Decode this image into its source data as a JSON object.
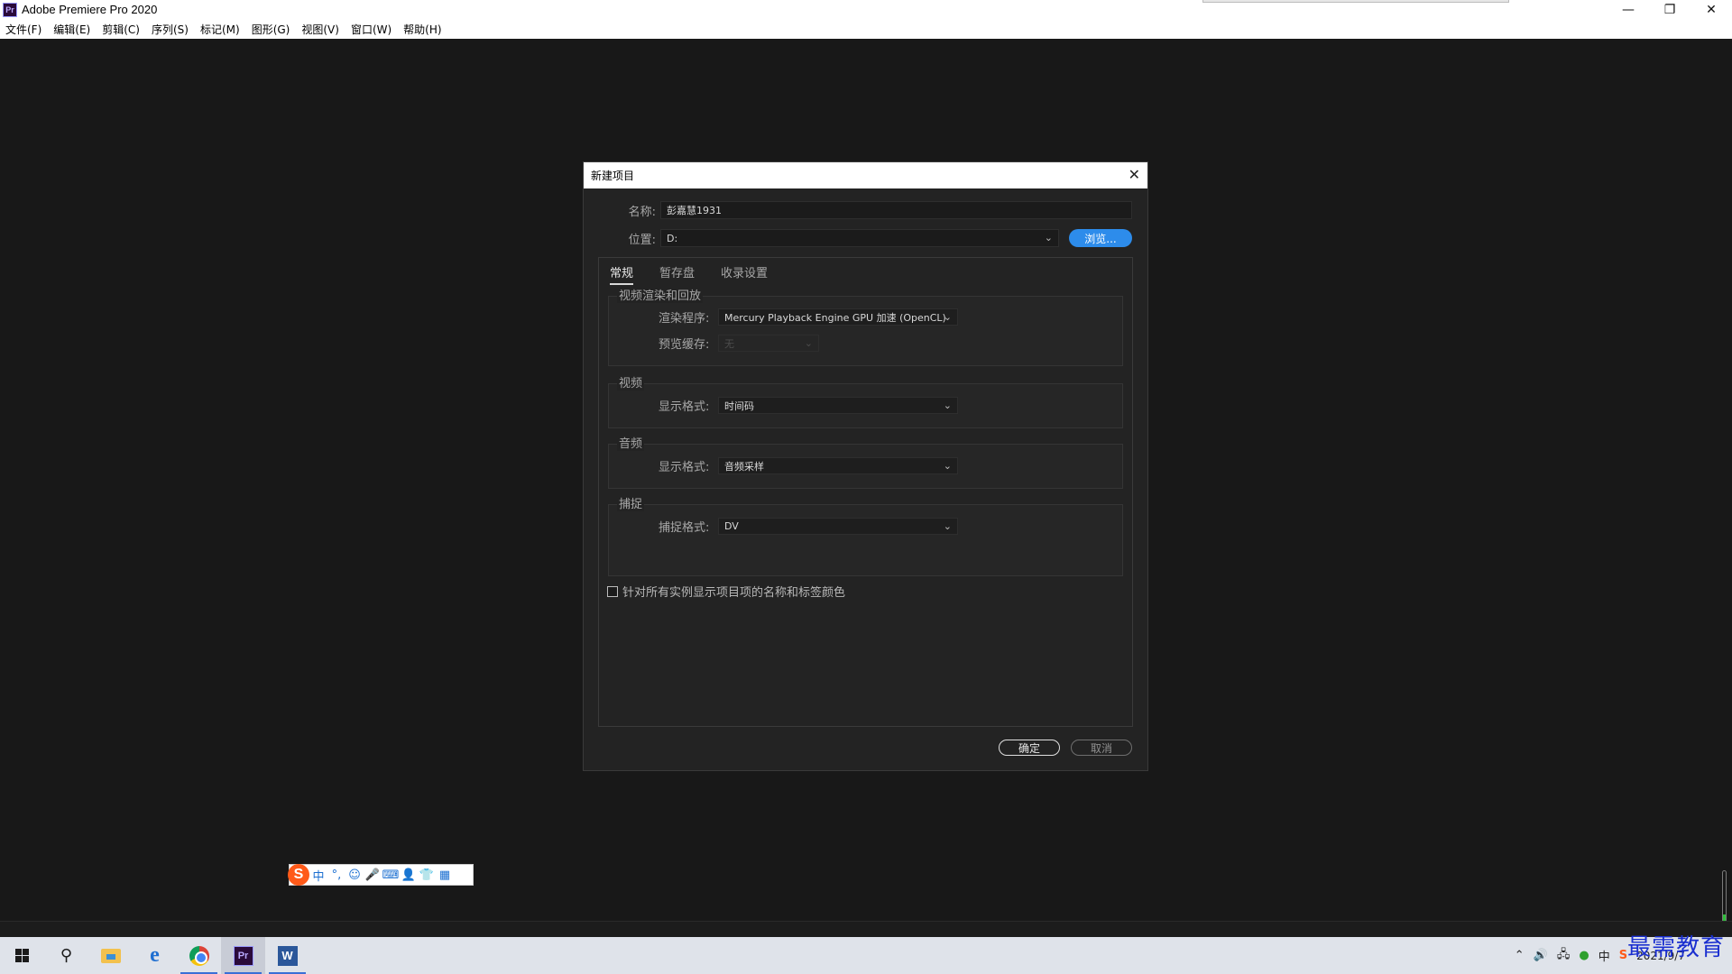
{
  "window": {
    "title": "Adobe Premiere Pro 2020",
    "controls": [
      "—",
      "❐",
      "✕"
    ]
  },
  "menu": [
    "文件(F)",
    "编辑(E)",
    "剪辑(C)",
    "序列(S)",
    "标记(M)",
    "图形(G)",
    "视图(V)",
    "窗口(W)",
    "帮助(H)"
  ],
  "dialog": {
    "title": "新建项目",
    "name_label": "名称:",
    "name_value": "彭嘉慧1931",
    "location_label": "位置:",
    "location_value": "D:",
    "browse_label": "浏览...",
    "tabs": [
      "常规",
      "暂存盘",
      "收录设置"
    ],
    "groups": {
      "render": {
        "title": "视频渲染和回放",
        "renderer_label": "渲染程序:",
        "renderer_value": "Mercury Playback Engine GPU 加速 (OpenCL)",
        "preview_cache_label": "预览缓存:",
        "preview_cache_value": "无"
      },
      "video": {
        "title": "视频",
        "format_label": "显示格式:",
        "format_value": "时间码"
      },
      "audio": {
        "title": "音频",
        "format_label": "显示格式:",
        "format_value": "音频采样"
      },
      "capture": {
        "title": "捕捉",
        "format_label": "捕捉格式:",
        "format_value": "DV"
      }
    },
    "checkbox_label": "针对所有实例显示项目项的名称和标签颜色",
    "checkbox_checked": false,
    "ok_label": "确定",
    "cancel_label": "取消"
  },
  "ime": {
    "logo": "S",
    "items": [
      "中",
      "°,",
      "☺",
      "🎤",
      "⌨",
      "👤",
      "👕",
      "▦"
    ]
  },
  "taskbar": {
    "apps": [
      "start",
      "search",
      "file-explorer",
      "edge",
      "chrome",
      "premiere-pro",
      "word"
    ],
    "pr_label": "Pr",
    "word_label": "W",
    "clock_date": "2021/9/7"
  },
  "watermark": "最需教育",
  "colors": {
    "accent": "#2d8ceb",
    "dialog_bg": "#232323",
    "app_bg": "#181818"
  }
}
